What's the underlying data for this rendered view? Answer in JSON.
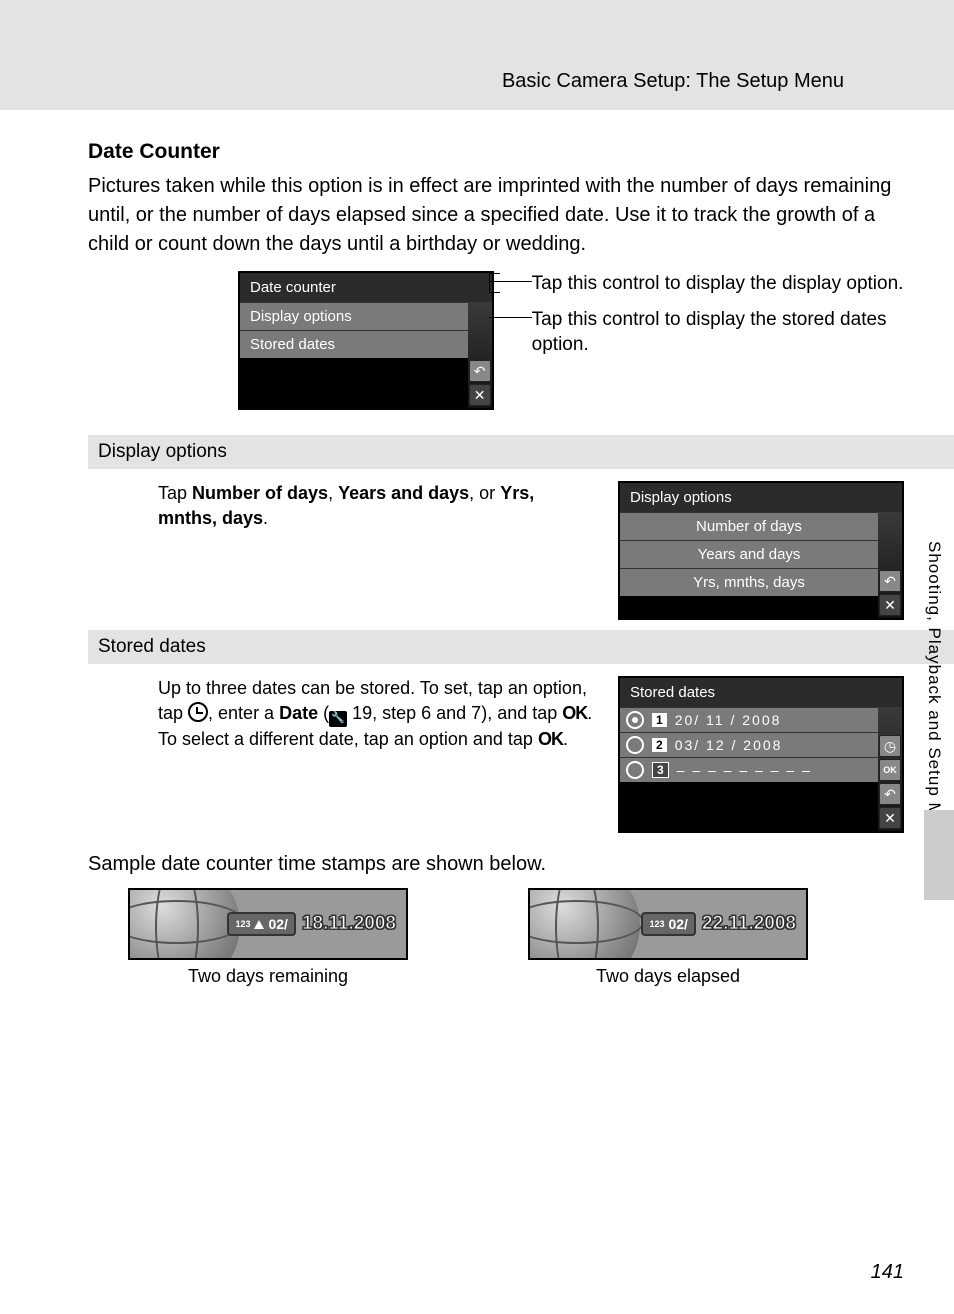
{
  "header": "Basic Camera Setup: The Setup Menu",
  "title": "Date Counter",
  "intro": "Pictures taken while this option is in effect are imprinted with the number of days remaining until, or the number of days elapsed since a specified date. Use it to track the growth of a child or count down the days until a birthday or wedding.",
  "menu1": {
    "title": "Date counter",
    "items": [
      "Display options",
      "Stored dates"
    ]
  },
  "callouts": {
    "display": "Tap this control to display the display option.",
    "stored": "Tap this control to display the stored dates option."
  },
  "display_options": {
    "heading": "Display options",
    "text_pre": "Tap ",
    "opt1": "Number of days",
    "sep1": ", ",
    "opt2": "Years and days",
    "sep2": ", or ",
    "opt3": "Yrs, mnths, days",
    "text_post": ".",
    "screen_title": "Display options",
    "screen_items": [
      "Number of days",
      "Years and days",
      "Yrs, mnths, days"
    ]
  },
  "stored_dates": {
    "heading": "Stored dates",
    "text1": "Up to three dates can be stored. To set, tap an option, tap ",
    "text2": ", enter a ",
    "date_label": "Date",
    "text3": " (",
    "ref": " 19, step 6 and 7), and tap ",
    "ok1": "OK",
    "text4": ". To select a different date, tap an option and tap ",
    "ok2": "OK",
    "text5": ".",
    "screen_title": "Stored dates",
    "rows": [
      {
        "n": "1",
        "date": "20/ 11 / 2008",
        "sel": true
      },
      {
        "n": "2",
        "date": "03/ 12 / 2008",
        "sel": false
      },
      {
        "n": "3",
        "date": "– – – – – – – – –",
        "sel": false
      }
    ]
  },
  "sample_caption": "Sample date counter time stamps are shown below.",
  "samples": {
    "left": {
      "badge": "02/",
      "date": "18.11.2008",
      "label": "Two days remaining",
      "arrow": true
    },
    "right": {
      "badge": "02/",
      "date": "22.11.2008",
      "label": "Two days elapsed",
      "arrow": false
    }
  },
  "side_tab": "Shooting, Playback and Setup Menus",
  "page_number": "141"
}
